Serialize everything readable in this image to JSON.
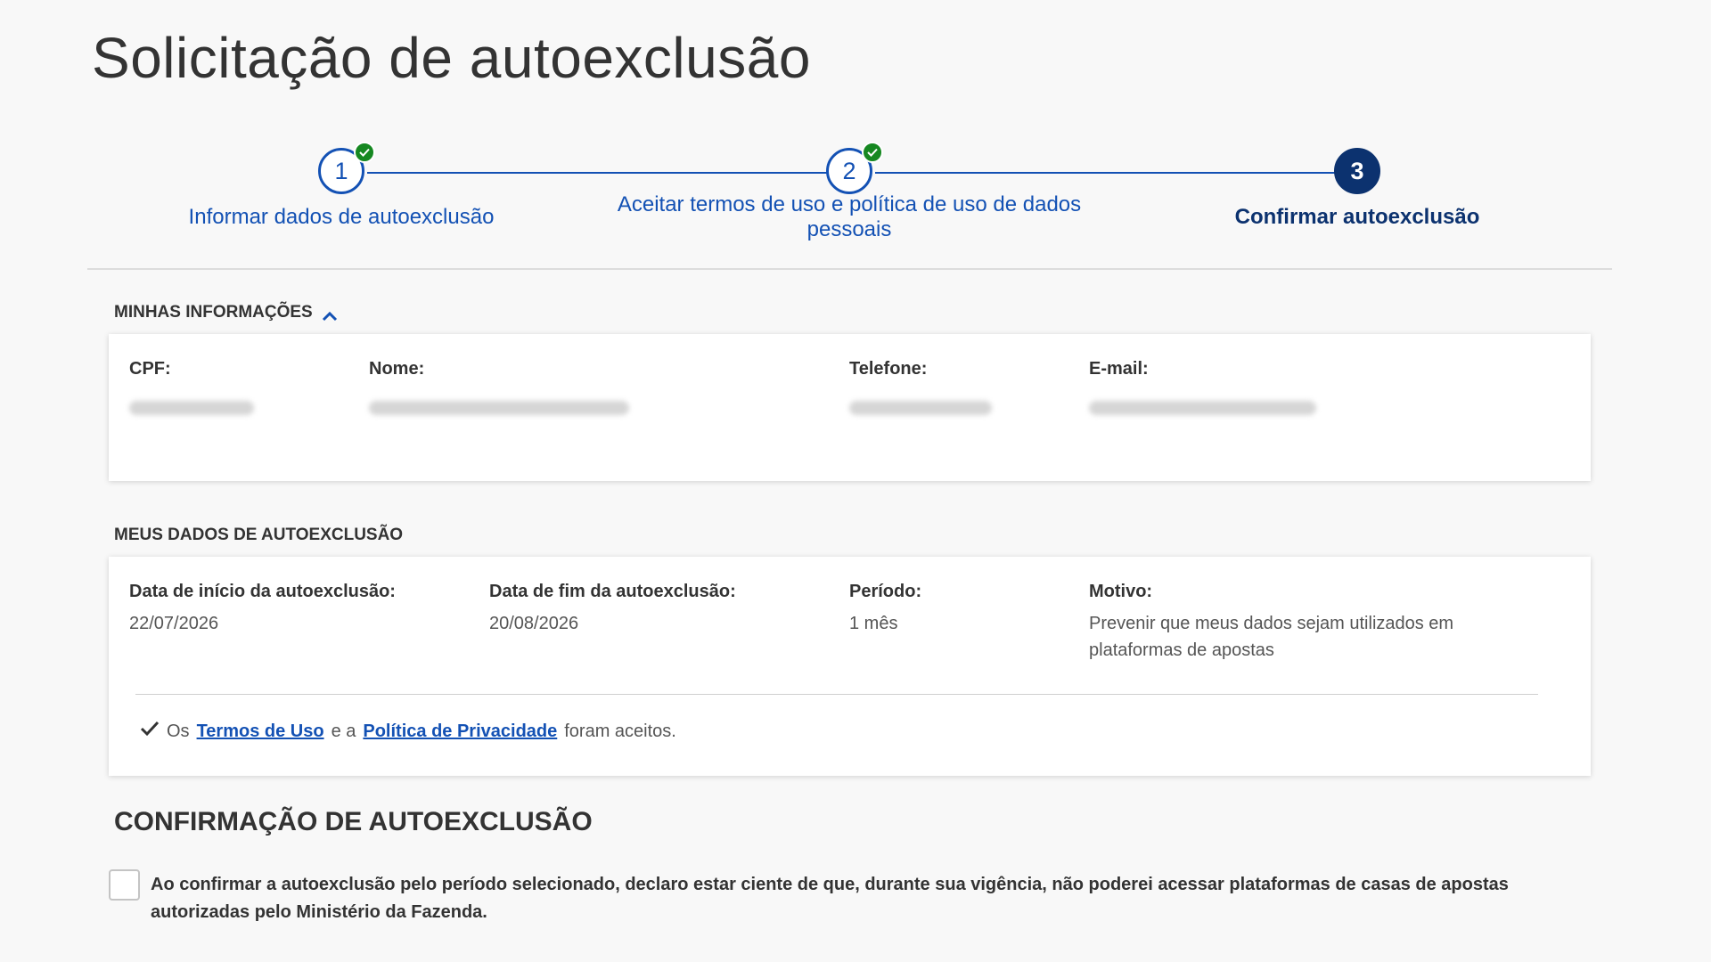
{
  "page": {
    "title": "Solicitação de autoexclusão"
  },
  "stepper": {
    "steps": [
      {
        "number": "1",
        "label": "Informar dados de autoexclusão",
        "status": "completed"
      },
      {
        "number": "2",
        "label": "Aceitar termos de uso e política de uso de dados pessoais",
        "status": "completed"
      },
      {
        "number": "3",
        "label": "Confirmar autoexclusão",
        "status": "active"
      }
    ]
  },
  "my_info": {
    "heading": "MINHAS INFORMAÇÕES",
    "fields": {
      "cpf_label": "CPF:",
      "name_label": "Nome:",
      "phone_label": "Telefone:",
      "email_label": "E-mail:"
    }
  },
  "exclusion_data": {
    "heading": "MEUS DADOS DE AUTOEXCLUSÃO",
    "start_label": "Data de início da autoexclusão:",
    "start_value": "22/07/2026",
    "end_label": "Data de fim da autoexclusão:",
    "end_value": "20/08/2026",
    "period_label": "Período:",
    "period_value": "1 mês",
    "reason_label": "Motivo:",
    "reason_value": "Prevenir que meus dados sejam utilizados em plataformas de apostas",
    "terms": {
      "prefix": "Os",
      "terms_link": "Termos de Uso",
      "middle": "e a",
      "privacy_link": "Política de Privacidade",
      "suffix": "foram aceitos."
    }
  },
  "confirmation": {
    "title": "CONFIRMAÇÃO DE AUTOEXCLUSÃO",
    "checkbox_checked": false,
    "text": "Ao confirmar a autoexclusão pelo período selecionado, declaro estar ciente de que, durante sua vigência, não poderei acessar plataformas de casas de apostas autorizadas pelo Ministério da Fazenda."
  },
  "colors": {
    "primary": "#1351b4",
    "primary_dark": "#0c326f",
    "success": "#168821",
    "background": "#f8f8f8",
    "text": "#333333"
  }
}
